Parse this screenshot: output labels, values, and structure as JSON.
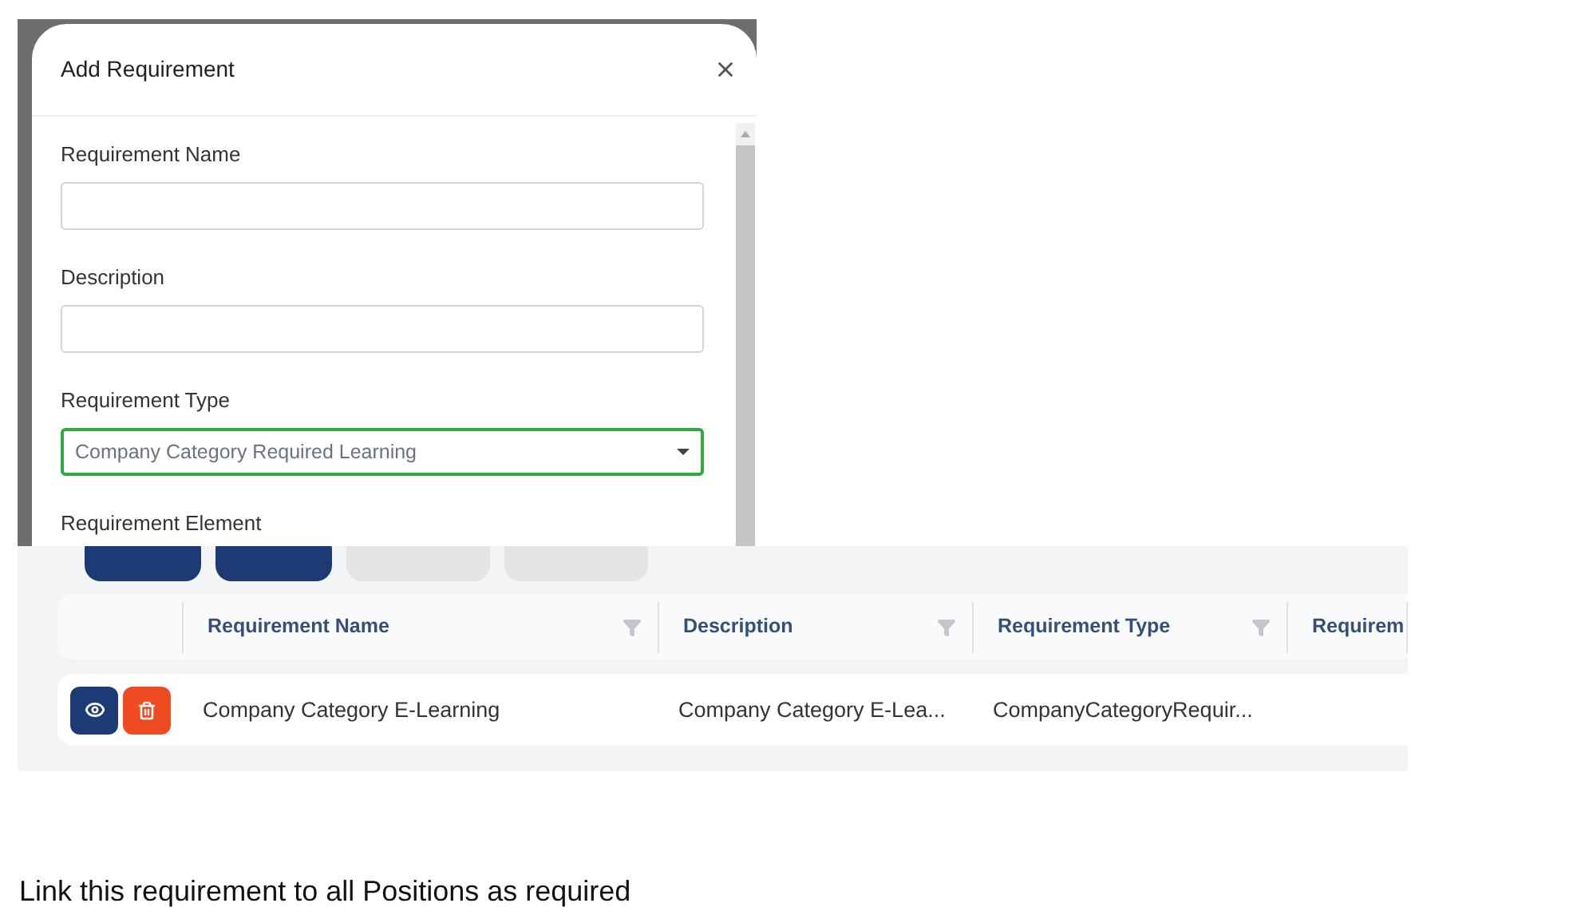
{
  "dialog": {
    "title": "Add Requirement",
    "fields": [
      {
        "label": "Requirement Name",
        "kind": "text"
      },
      {
        "label": "Description",
        "kind": "text"
      },
      {
        "label": "Requirement Type",
        "kind": "select",
        "value": "Company Category Required Learning"
      },
      {
        "label": "Requirement Element",
        "kind": "cut"
      }
    ]
  },
  "grid": {
    "toolbar_buttons": [
      {
        "kind": "primary"
      },
      {
        "kind": "primary"
      },
      {
        "kind": "secondary"
      },
      {
        "kind": "secondary"
      }
    ],
    "columns": [
      {
        "label": "Requirement Name",
        "filter": true
      },
      {
        "label": "Description",
        "filter": true
      },
      {
        "label": "Requirement Type",
        "filter": true
      },
      {
        "label": "Requirem",
        "filter": false
      }
    ],
    "rows": [
      {
        "actions": [
          {
            "kind": "view"
          },
          {
            "kind": "delete"
          }
        ],
        "cells": [
          "Company Category E-Learning",
          "Company Category E-Lea...",
          "CompanyCategoryRequir...",
          null
        ]
      }
    ]
  },
  "caption": "Link this requirement to all Positions as required"
}
